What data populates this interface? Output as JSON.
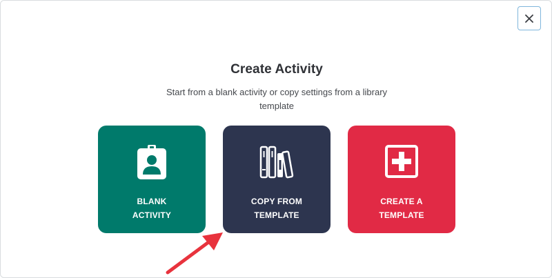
{
  "dialog": {
    "title": "Create Activity",
    "subtitle": "Start from a blank activity or copy settings from a library template"
  },
  "close_button": {
    "icon": "close-icon",
    "symbol": "✕"
  },
  "options": [
    {
      "key": "blank",
      "label": "BLANK\nACTIVITY",
      "icon": "id-badge-icon",
      "color": "#007a6b"
    },
    {
      "key": "copy",
      "label": "COPY FROM\nTEMPLATE",
      "icon": "books-icon",
      "color": "#2d354f"
    },
    {
      "key": "create",
      "label": "CREATE A\nTEMPLATE",
      "icon": "plus-square-icon",
      "color": "#e12a45"
    }
  ],
  "annotation": {
    "icon": "pointer-arrow-icon",
    "color": "#e8333d"
  }
}
